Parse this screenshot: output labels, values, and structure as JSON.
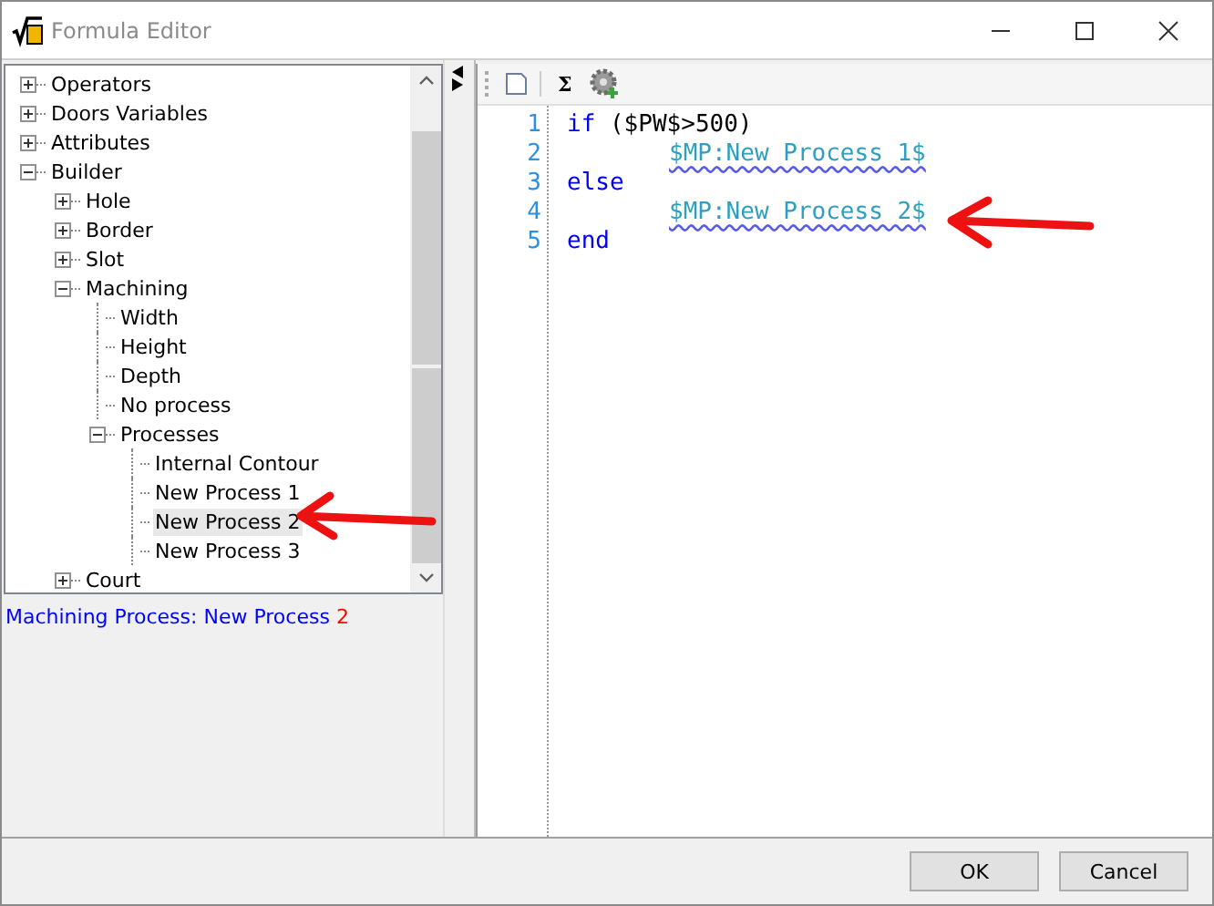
{
  "window": {
    "title": "Formula Editor"
  },
  "tree": [
    {
      "label": "Operators",
      "expanded": false,
      "selected": false
    },
    {
      "label": "Doors Variables",
      "expanded": false,
      "selected": false
    },
    {
      "label": "Attributes",
      "expanded": false,
      "selected": false
    },
    {
      "label": "Builder",
      "expanded": true,
      "selected": false,
      "children": [
        {
          "label": "Hole",
          "expanded": false,
          "selected": false
        },
        {
          "label": "Border",
          "expanded": false,
          "selected": false
        },
        {
          "label": "Slot",
          "expanded": false,
          "selected": false
        },
        {
          "label": "Machining",
          "expanded": true,
          "selected": false,
          "children": [
            {
              "label": "Width",
              "selected": false
            },
            {
              "label": "Height",
              "selected": false
            },
            {
              "label": "Depth",
              "selected": false
            },
            {
              "label": "No process",
              "selected": false
            },
            {
              "label": "Processes",
              "expanded": true,
              "selected": false,
              "children": [
                {
                  "label": "Internal Contour",
                  "selected": false
                },
                {
                  "label": "New Process 1",
                  "selected": false
                },
                {
                  "label": "New Process 2",
                  "selected": true
                },
                {
                  "label": "New Process 3",
                  "selected": false
                }
              ]
            }
          ]
        },
        {
          "label": "Court",
          "expanded": false,
          "selected": false
        }
      ]
    }
  ],
  "status": [
    {
      "text": "Machining Process: New Process ",
      "color": "#0000ff"
    },
    {
      "text": "2",
      "color": "#ff0000"
    }
  ],
  "toolbar": {
    "sum_label": "Σ"
  },
  "code_lines": [
    {
      "number": "1",
      "indented": false,
      "tokens": [
        {
          "kind": "keyword",
          "text": "if"
        },
        {
          "kind": "plain",
          "text": " ($PW$>500)"
        }
      ]
    },
    {
      "number": "2",
      "indented": true,
      "tokens": [
        {
          "kind": "variable",
          "text": "$MP:New Process 1$"
        }
      ]
    },
    {
      "number": "3",
      "indented": false,
      "tokens": [
        {
          "kind": "keyword",
          "text": "else"
        }
      ]
    },
    {
      "number": "4",
      "indented": true,
      "tokens": [
        {
          "kind": "variable",
          "text": "$MP:New Process 2$"
        }
      ]
    },
    {
      "number": "5",
      "indented": false,
      "tokens": [
        {
          "kind": "keyword",
          "text": "end"
        }
      ]
    }
  ],
  "buttons": [
    {
      "label": "OK"
    },
    {
      "label": "Cancel"
    }
  ]
}
